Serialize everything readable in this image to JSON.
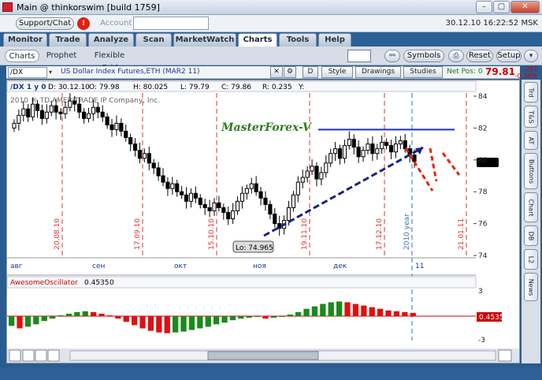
{
  "window": {
    "title": "Main @ thinkorswim [build 1759]",
    "controls": [
      "–",
      "▢",
      "✕"
    ]
  },
  "toolbar": {
    "support_label": "Support/Chat",
    "alert_count": "!",
    "account_label": "Account",
    "datetime": "30.12.10 16:22:52 MSK"
  },
  "tabs": [
    "Monitor",
    "Trade",
    "Analyze",
    "Scan",
    "MarketWatch",
    "Charts",
    "Tools",
    "Help"
  ],
  "active_tab": "Charts",
  "subtabs": [
    "Charts",
    "Prophet",
    "Flexible Grid"
  ],
  "right_buttons": {
    "symbols": "Symbols",
    "reset": "Reset",
    "setup": "Setup"
  },
  "chart_header": {
    "symbol": "/DX",
    "description": "US Dollar Index Futures,ETH (MAR2 11)",
    "d_button": "D",
    "style": "Style",
    "drawings": "Drawings",
    "studies": "Studies",
    "net_pos": "Net Pos: 0",
    "last_price": "79.81",
    "change": "-.292",
    "change_pct": "-0.36%"
  },
  "ohlc": {
    "sym": "/DX 1 y 0",
    "date": "D: 30.12.10",
    "open": "O: 79.98",
    "high": "H: 80.025",
    "low": "L: 79.79",
    "close": "C: 79.86",
    "range": "R: 0.235",
    "y": "Y:"
  },
  "copyright": "2010 ® TD AMERITRADE IP Company, Inc.",
  "watermark": "MasterForex-V",
  "low_label": "Lo: 74.965",
  "date_markers": [
    "20.08.10",
    "17.09.10",
    "15.10.10",
    "19.11.10",
    "17.12.10",
    "2010 year",
    "21.01.11"
  ],
  "month_labels": [
    "авг",
    "сен",
    "окт",
    "ноя",
    "дек",
    "11"
  ],
  "price_ticks": [
    "84",
    "82",
    "80",
    "78",
    "76",
    "74"
  ],
  "oscillator": {
    "name": "AwesomeOscillator",
    "value": "0.4535",
    "zero": "0",
    "ticks": [
      "3",
      "0",
      "-3"
    ],
    "tag": "0.4535"
  },
  "sidebar_tabs": [
    "Trd",
    "T&S",
    "AT",
    "Buttons",
    "Chart",
    "DB",
    "L2",
    "News"
  ],
  "chart_data": {
    "type": "candlestick",
    "symbol": "/DX",
    "ylim": [
      74,
      84
    ],
    "candles_close": [
      82.3,
      82.8,
      83.2,
      82.7,
      83.5,
      83.1,
      82.6,
      83.0,
      83.4,
      83.0,
      82.9,
      83.3,
      83.7,
      83.5,
      83.0,
      82.6,
      82.9,
      83.3,
      83.0,
      82.7,
      82.2,
      81.9,
      82.3,
      81.8,
      81.4,
      81.0,
      80.6,
      80.1,
      80.4,
      79.8,
      79.5,
      79.0,
      78.6,
      78.2,
      78.5,
      78.0,
      77.8,
      77.4,
      77.9,
      77.6,
      77.2,
      77.0,
      76.8,
      77.3,
      77.0,
      76.7,
      76.3,
      76.8,
      77.4,
      77.9,
      78.2,
      78.5,
      78.0,
      77.6,
      77.2,
      76.6,
      76.0,
      75.7,
      76.2,
      77.0,
      77.8,
      78.6,
      78.9,
      79.3,
      79.6,
      78.8,
      79.2,
      79.8,
      80.4,
      80.7,
      80.1,
      80.9,
      81.3,
      80.8,
      80.2,
      80.6,
      81.0,
      80.4,
      80.7,
      81.1,
      80.9,
      80.5,
      81.0,
      81.2,
      80.7,
      80.3,
      79.9
    ],
    "blue_line_level": 81.9,
    "ao_values": [
      -1.2,
      -1.5,
      -1.3,
      -1.0,
      -0.6,
      -0.3,
      0.1,
      0.3,
      0.5,
      0.6,
      0.5,
      0.3,
      0.1,
      -0.3,
      -0.7,
      -1.1,
      -1.5,
      -1.8,
      -2.0,
      -2.1,
      -2.0,
      -1.9,
      -1.7,
      -1.5,
      -1.3,
      -1.0,
      -0.8,
      -0.5,
      -0.3,
      -0.2,
      -0.1,
      -0.3,
      -0.2,
      0.0,
      0.2,
      0.5,
      0.9,
      1.2,
      1.5,
      1.7,
      1.8,
      1.7,
      1.5,
      1.3,
      1.1,
      0.9,
      0.7,
      0.6,
      0.5,
      0.4
    ]
  }
}
